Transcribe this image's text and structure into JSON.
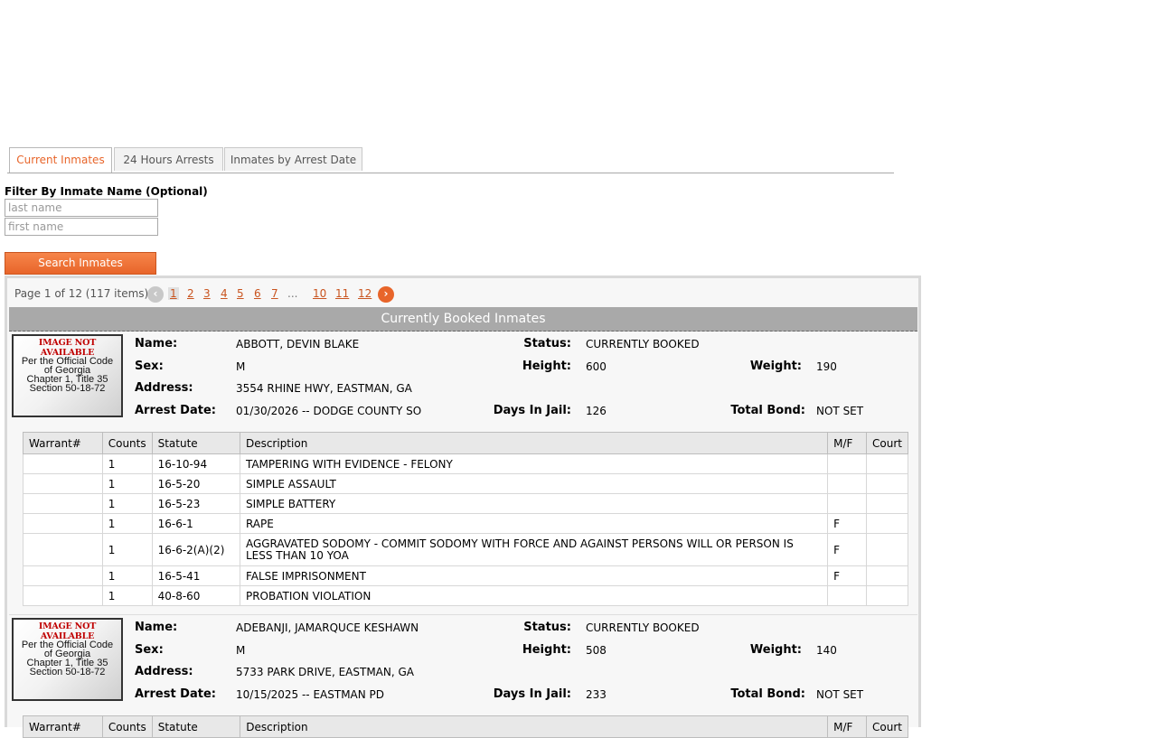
{
  "tabs": [
    {
      "label": "Current Inmates",
      "active": true
    },
    {
      "label": "24 Hours Arrests",
      "active": false
    },
    {
      "label": "Inmates by Arrest Date",
      "active": false
    }
  ],
  "filter": {
    "label": "Filter By Inmate Name (Optional)",
    "last_placeholder": "last name",
    "first_placeholder": "first name",
    "search_label": "Search Inmates"
  },
  "pager": {
    "info": "Page 1 of 12 (117 items)",
    "prev": "‹",
    "next": "›",
    "pages": [
      "1",
      "2",
      "3",
      "4",
      "5",
      "6",
      "7",
      "10",
      "11",
      "12"
    ],
    "ellipsis": "...",
    "current": "1"
  },
  "results_title": "Currently Booked Inmates",
  "labels": {
    "name": "Name:",
    "sex": "Sex:",
    "address": "Address:",
    "arrest_date": "Arrest Date:",
    "status": "Status:",
    "height": "Height:",
    "weight": "Weight:",
    "days_in_jail": "Days In Jail:",
    "total_bond": "Total Bond:"
  },
  "photo": {
    "not_available": "IMAGE NOT AVAILABLE",
    "code_lines": [
      "Per the Official Code",
      "of Georgia",
      "Chapter 1, Title 35",
      "Section 50-18-72"
    ]
  },
  "charge_headers": [
    "Warrant#",
    "Counts",
    "Statute",
    "Description",
    "M/F",
    "Court"
  ],
  "inmates": [
    {
      "name": "ABBOTT, DEVIN BLAKE",
      "status": "CURRENTLY BOOKED",
      "sex": "M",
      "height": "600",
      "weight": "190",
      "address": "3554 RHINE HWY, EASTMAN, GA",
      "arrest_date": "01/30/2026 -- DODGE COUNTY SO",
      "days_in_jail": "126",
      "total_bond": "NOT SET",
      "charges": [
        {
          "warrant": "",
          "counts": "1",
          "statute": "16-10-94",
          "description": "TAMPERING WITH EVIDENCE - FELONY",
          "mf": "",
          "court": ""
        },
        {
          "warrant": "",
          "counts": "1",
          "statute": "16-5-20",
          "description": "SIMPLE ASSAULT",
          "mf": "",
          "court": ""
        },
        {
          "warrant": "",
          "counts": "1",
          "statute": "16-5-23",
          "description": "SIMPLE BATTERY",
          "mf": "",
          "court": ""
        },
        {
          "warrant": "",
          "counts": "1",
          "statute": "16-6-1",
          "description": "RAPE",
          "mf": "F",
          "court": ""
        },
        {
          "warrant": "",
          "counts": "1",
          "statute": "16-6-2(A)(2)",
          "description": "AGGRAVATED SODOMY - COMMIT SODOMY WITH FORCE AND AGAINST PERSONS WILL OR PERSON IS LESS THAN 10 YOA",
          "mf": "F",
          "court": ""
        },
        {
          "warrant": "",
          "counts": "1",
          "statute": "16-5-41",
          "description": "FALSE IMPRISONMENT",
          "mf": "F",
          "court": ""
        },
        {
          "warrant": "",
          "counts": "1",
          "statute": "40-8-60",
          "description": "PROBATION VIOLATION",
          "mf": "",
          "court": ""
        }
      ]
    },
    {
      "name": "ADEBANJI, JAMARQUCE KESHAWN",
      "status": "CURRENTLY BOOKED",
      "sex": "M",
      "height": "508",
      "weight": "140",
      "address": "5733 PARK DRIVE, EASTMAN, GA",
      "arrest_date": "10/15/2025 -- EASTMAN PD",
      "days_in_jail": "233",
      "total_bond": "NOT SET",
      "charges": []
    }
  ]
}
